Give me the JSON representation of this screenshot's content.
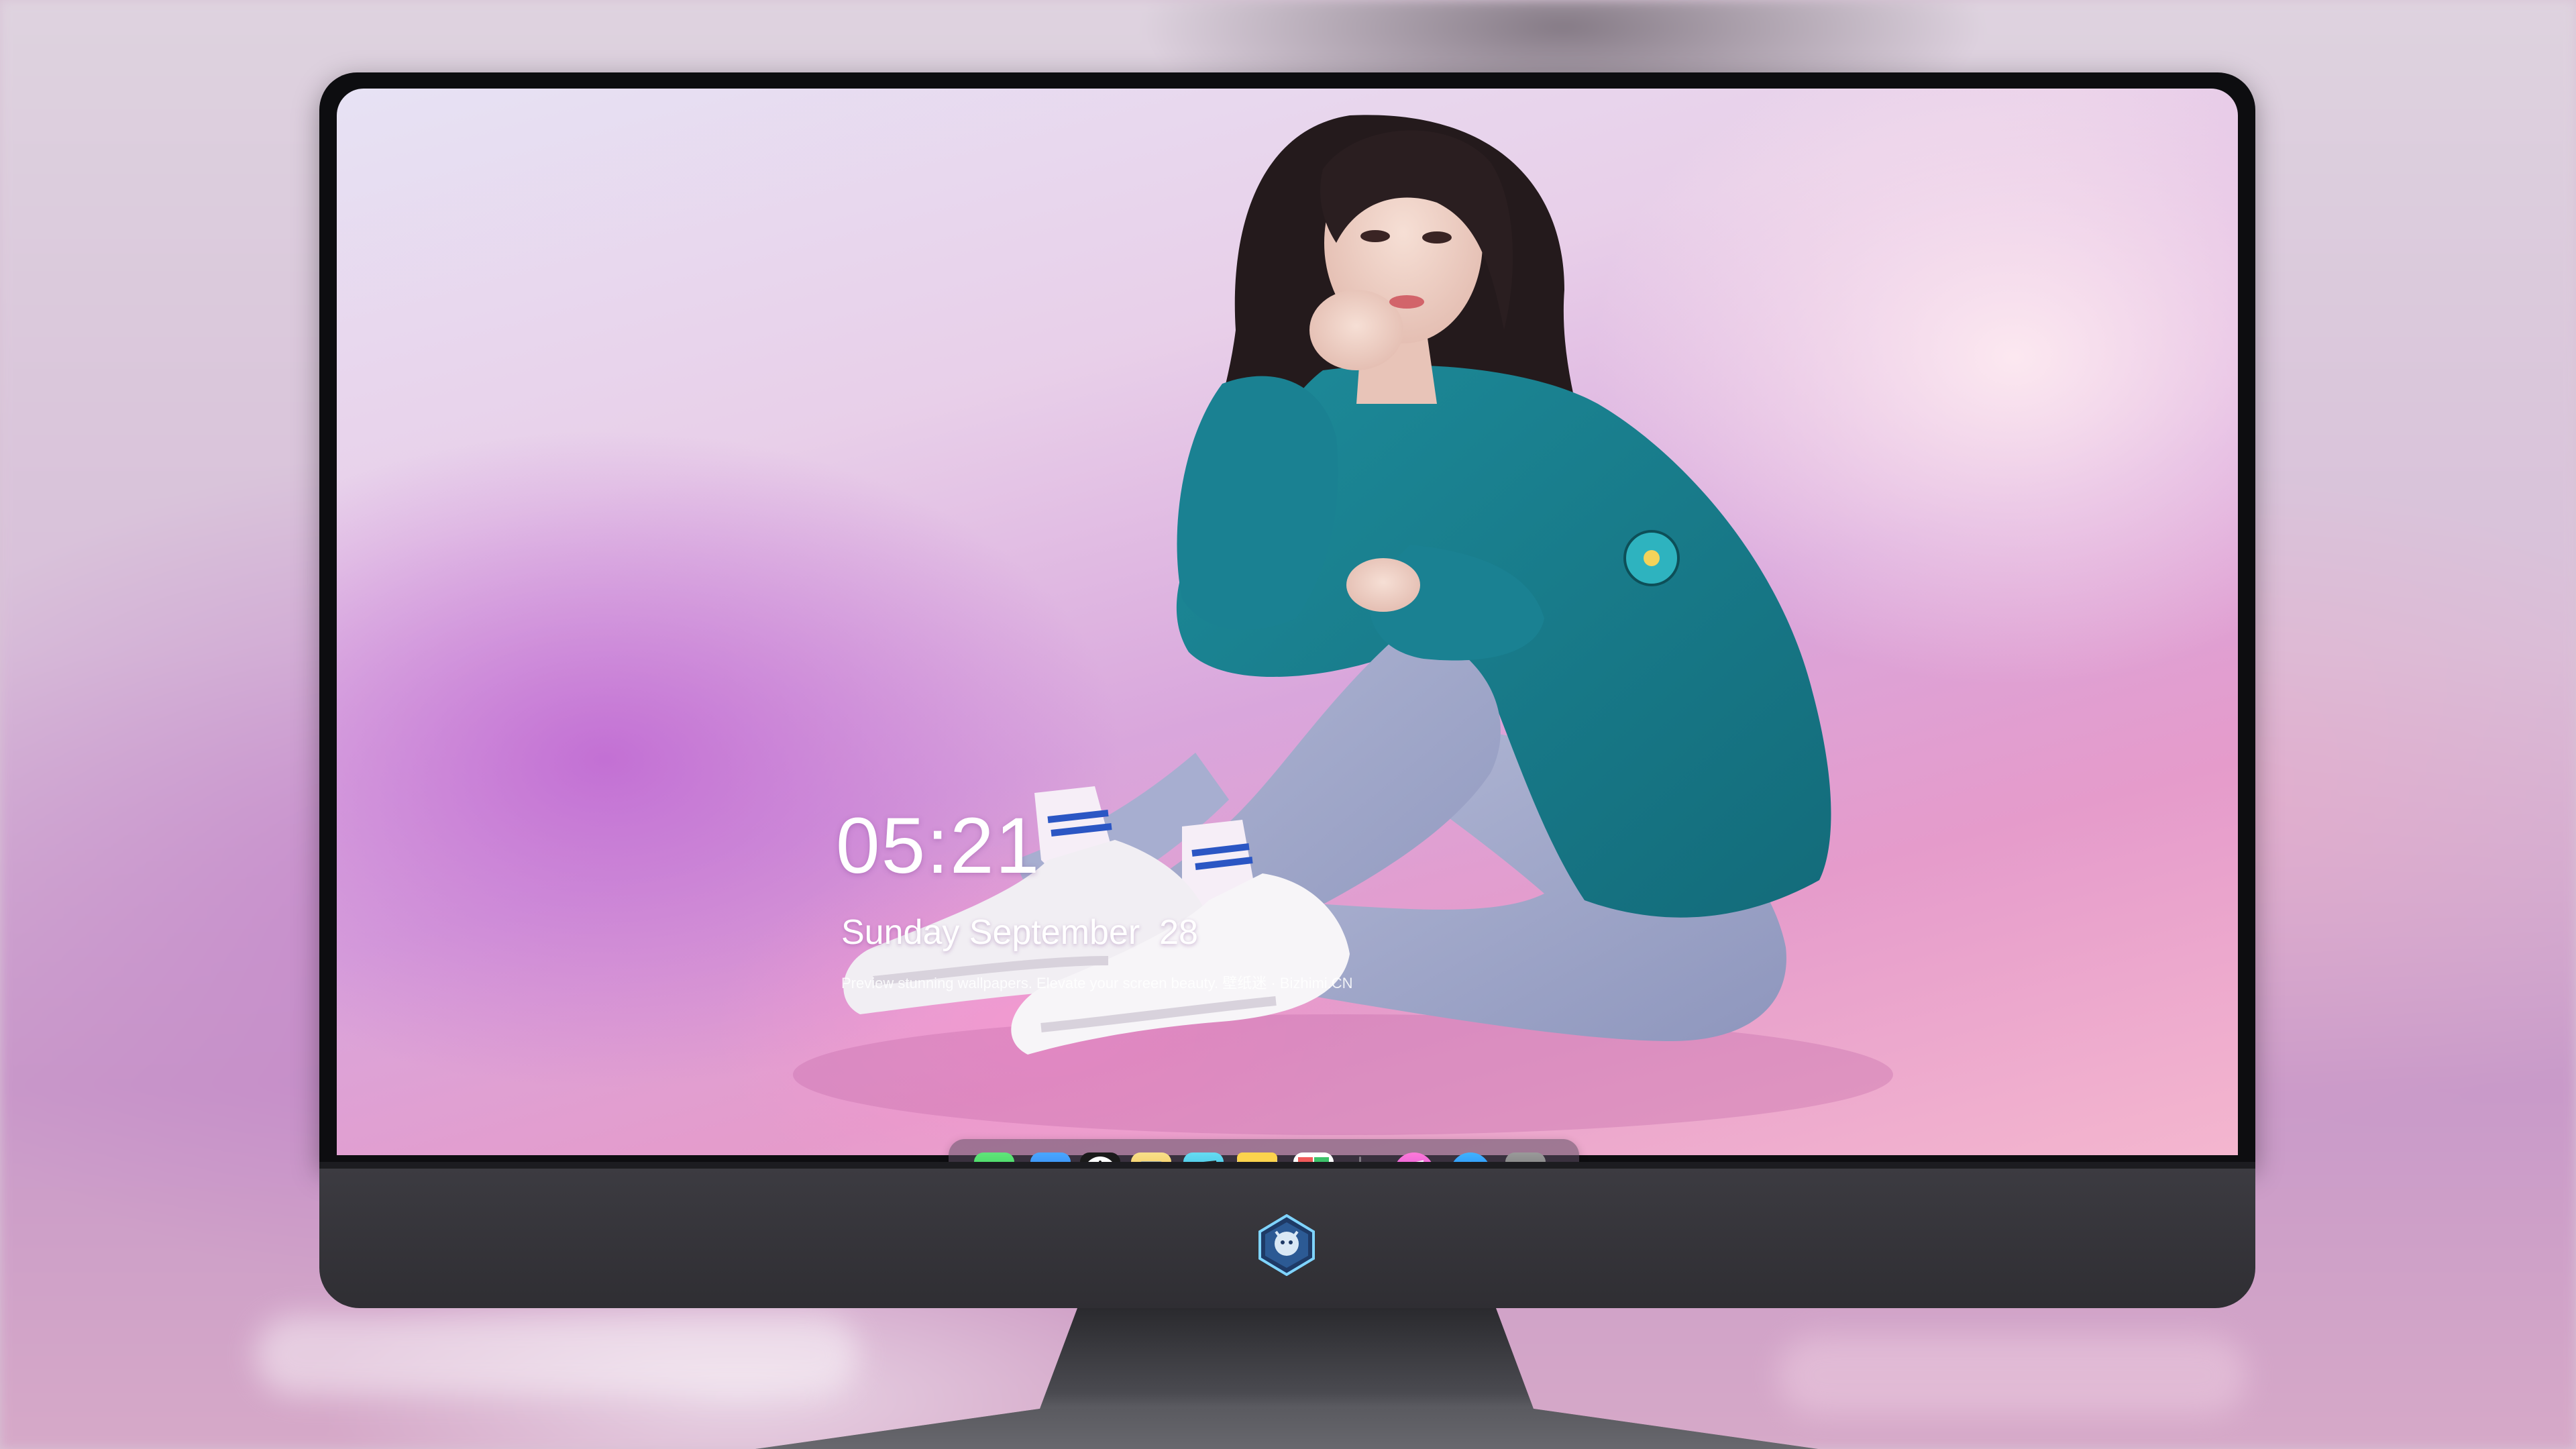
{
  "lockscreen": {
    "time": "05:21",
    "date": "Sunday September  28",
    "tagline": "Preview stunning wallpapers. Elevate your screen beauty. 壁纸迷 · Bizhimi.CN"
  },
  "dock": {
    "apps": [
      {
        "name": "messages-icon",
        "color": "#3ed35a"
      },
      {
        "name": "weather-icon",
        "color": "#2f8ff0"
      },
      {
        "name": "clock-icon",
        "color": "#1a1a1a"
      },
      {
        "name": "preview-icon",
        "color": "#f5c23a"
      },
      {
        "name": "clips-icon",
        "color": "#35c6e6"
      },
      {
        "name": "notes-icon",
        "color": "#fcd34d"
      },
      {
        "name": "photo-grid-icon",
        "color": "#f0f0f0"
      },
      {
        "name": "music-icon",
        "color": "#f050c8"
      },
      {
        "name": "app-store-icon",
        "color": "#1e8ff5"
      },
      {
        "name": "camera-icon",
        "color": "#707070"
      }
    ]
  }
}
